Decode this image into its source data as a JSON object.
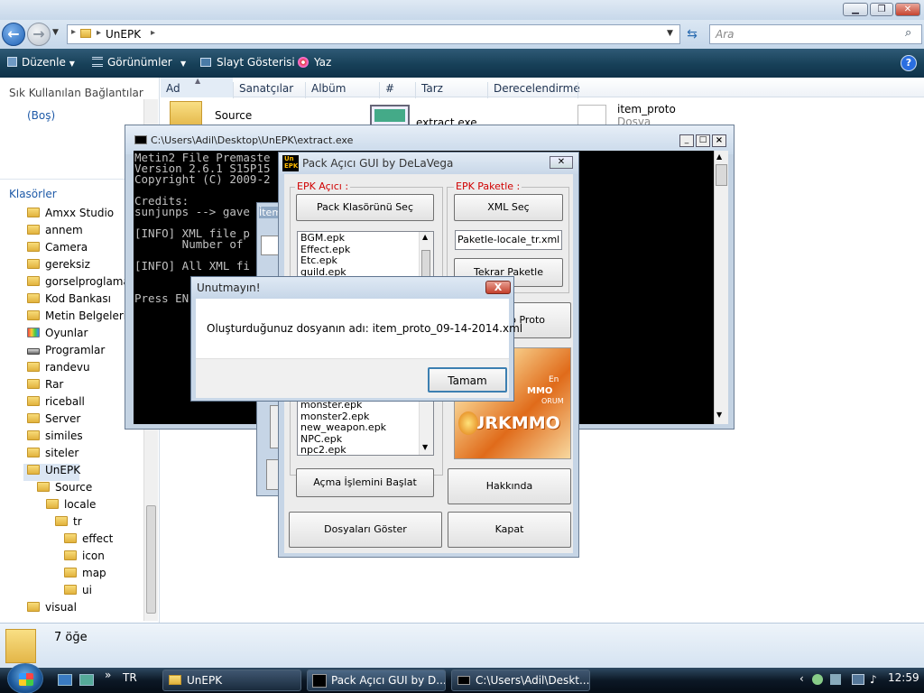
{
  "explorer": {
    "path_segment": "UnEPK",
    "search_placeholder": "Ara",
    "toolbar": {
      "organize": "Düzenle",
      "views": "Görünümler",
      "slideshow": "Slayt Gösterisi",
      "write": "Yaz"
    },
    "nav": {
      "favorites_header": "Sık Kullanılan Bağlantılar",
      "favorites_empty": "(Boş)",
      "folders_header": "Klasörler",
      "folders": [
        "Amxx Studio",
        "annem",
        "Camera",
        "gereksiz",
        "gorselproglama",
        "Kod Bankası",
        "Metin Belgelerim",
        "Oyunlar",
        "Programlar",
        "randevu",
        "Rar",
        "riceball",
        "Server",
        "similes",
        "siteler",
        "UnEPK"
      ],
      "subfolders": {
        "source": "Source",
        "locale": "locale",
        "tr": "tr",
        "effect": "effect",
        "icon": "icon",
        "map": "map",
        "ui": "ui",
        "visual": "visual"
      }
    },
    "columns": [
      "Ad",
      "Sanatçılar",
      "Albüm",
      "#",
      "Tarz",
      "Derecelendirme"
    ],
    "files": [
      {
        "name": "Source",
        "type": ""
      },
      {
        "name": "extract.exe",
        "type": ""
      },
      {
        "name": "item_proto",
        "type": "Dosya"
      }
    ],
    "details_count": "7 öğe"
  },
  "console": {
    "title": "C:\\Users\\Adil\\Desktop\\UnEPK\\extract.exe",
    "lines": "Metin2 File Premaste\nVersion 2.6.1 S15P15\nCopyright (C) 2009-2\n\nCredits:\nsunjunps --> gave\n\n[INFO] XML file p\n       Number of\n\n[INFO] All XML fi\n\n\nPress EN"
  },
  "hidden_window_label": "İtem",
  "pack_gui": {
    "title": "Pack Açıcı GUI by DeLaVega",
    "icon_text_top": "Un",
    "icon_text_bottom": "EPK",
    "epk_open_group": "EPK Açıcı :",
    "epk_pack_group": "EPK Paketle :",
    "select_pack_folder": "Pack Klasörünü Seç",
    "select_xml": "XML Seç",
    "xml_value": "Paketle-locale_tr.xml",
    "repack": "Tekrar Paketle",
    "proto_partial": "o Proto",
    "list_top": [
      "BGM.epk",
      "Effect.epk",
      "Etc.epk",
      "guild.epk"
    ],
    "list_bottom": [
      "monster.epk",
      "monster2.epk",
      "new_weapon.epk",
      "NPC.epk",
      "npc2.epk"
    ],
    "start_extract": "Açma İşlemini Başlat",
    "about": "Hakkında",
    "show_files": "Dosyaları Göster",
    "close": "Kapat",
    "logo_text": "URKMMO",
    "logo_small_1": "En",
    "logo_small_2": "MMO",
    "logo_small_3": "ORUM"
  },
  "dialog": {
    "title": "Unutmayın!",
    "message": "Oluşturduğunuz dosyanın adı: item_proto_09-14-2014.xml",
    "ok": "Tamam",
    "close": "X"
  },
  "taskbar": {
    "lang": "TR",
    "overflow": "»",
    "buttons": [
      "UnEPK",
      "Pack Açıcı GUI by D...",
      "C:\\Users\\Adil\\Deskt..."
    ],
    "clock": "12:59"
  }
}
